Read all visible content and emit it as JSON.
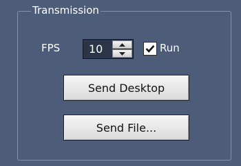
{
  "transmission": {
    "group_title": "Transmission",
    "fps_label": "FPS",
    "fps_value": "10",
    "run_label": "Run",
    "run_checked": true,
    "send_desktop_label": "Send Desktop",
    "send_file_label": "Send File..."
  },
  "icons": {
    "spin_up": "chevron-up-icon",
    "spin_down": "chevron-down-icon",
    "check": "checkmark-icon"
  },
  "colors": {
    "background": "#4d5c78",
    "group_border": "#8391ab",
    "text": "#ffffff",
    "button_face": "#e8e8e8"
  }
}
